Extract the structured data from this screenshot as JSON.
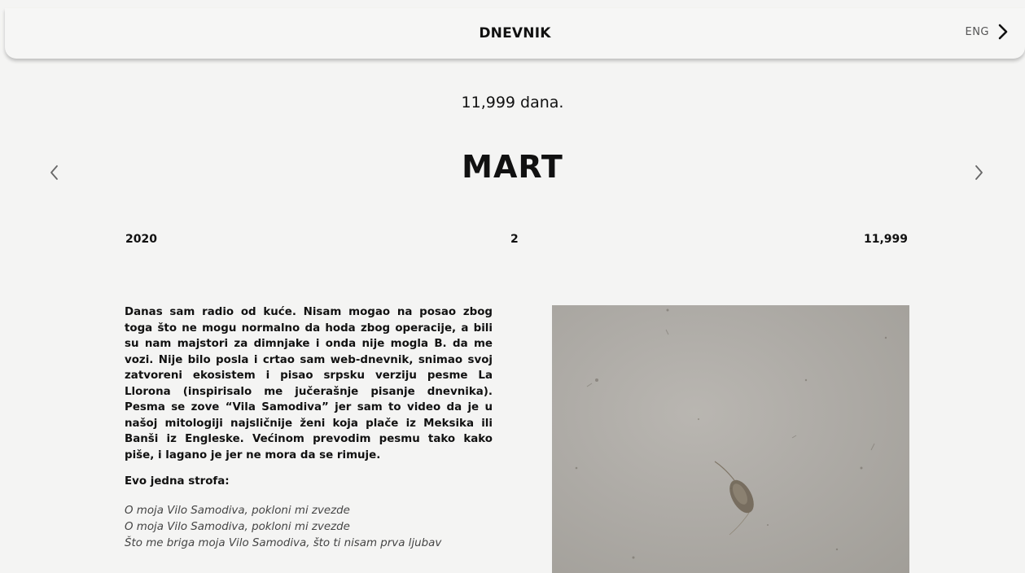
{
  "header": {
    "title": "DNEVNIK",
    "lang_label": "ENG",
    "lang_icon": "chevron-right-icon"
  },
  "days_count": "11,999 dana.",
  "month": {
    "name": "MART",
    "prev_icon": "chevron-left-icon",
    "next_icon": "chevron-right-icon"
  },
  "meta": {
    "year": "2020",
    "day": "2",
    "day_number": "11,999"
  },
  "entry": {
    "paragraph": "Danas sam radio od kuće. Nisam mogao na posao zbog toga što ne mogu normalno da hoda zbog operacije, a bili su nam majstori za dimnjake i onda nije mogla B. da me vozi. Nije bilo posla i crtao sam web-dnevnik, snimao svoj zatvoreni ekosistem i pisao srpsku verziju pesme La Llorona (inspirisalo me jučerašnje pisanje dnevnika). Pesma se zove “Vila Samodiva” jer sam to video da je u našoj mitologiji najsličnije ženi koja plače iz Meksika ili Banši iz Engleske. Većinom prevodim pesmu tako kako piše, i lagano je jer ne mora da se rimuje.",
    "strofa_heading": "Evo jedna strofa:",
    "verse": [
      "O moja Vilo Samodiva, pokloni mi zvezde",
      "O moja Vilo Samodiva, pokloni mi zvezde",
      "Što me briga moja Vilo Samodiva, što ti nisam prva ljubav"
    ]
  },
  "photo": {
    "icon": "ecosystem-photo"
  },
  "colors": {
    "background": "#f4f4f3",
    "text": "#111111",
    "verse": "#444444"
  }
}
